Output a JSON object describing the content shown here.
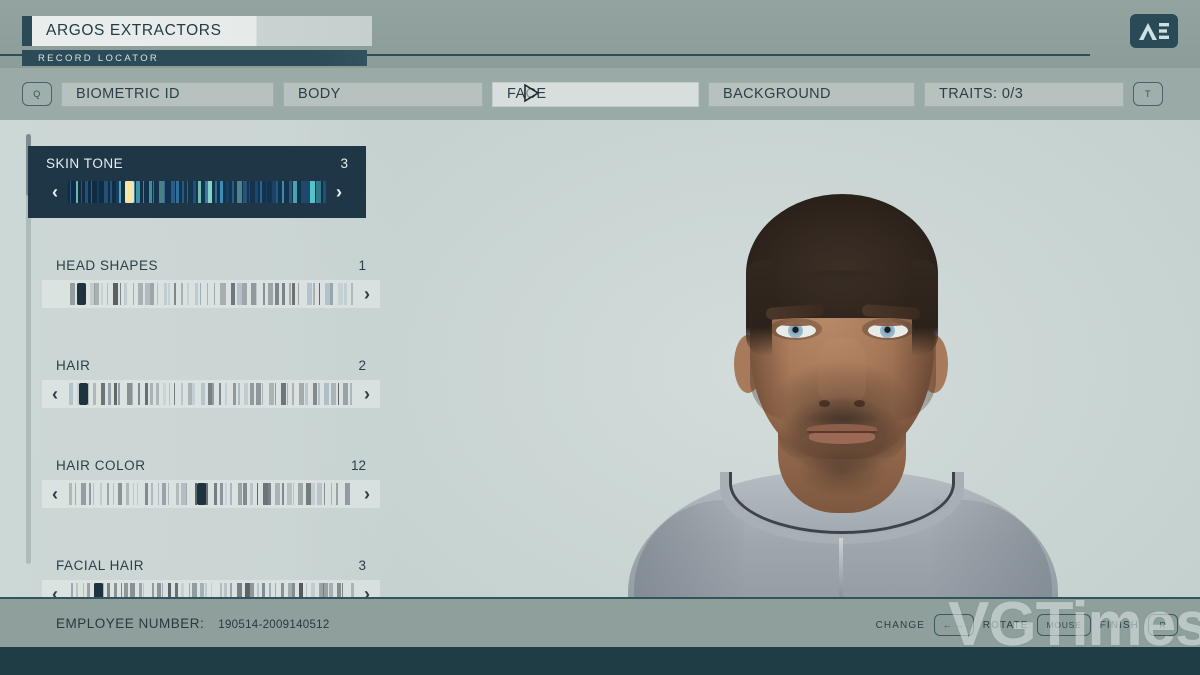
{
  "header": {
    "title": "ARGOS EXTRACTORS",
    "subtitle": "RECORD LOCATOR",
    "logo_icon": "ae-monogram-icon",
    "logo_text": "AE"
  },
  "tabs": {
    "prev_key": "Q",
    "next_key": "T",
    "items": [
      {
        "label": "BIOMETRIC ID",
        "active": false
      },
      {
        "label": "BODY",
        "active": false
      },
      {
        "label": "FACE",
        "active": true
      },
      {
        "label": "BACKGROUND",
        "active": false
      },
      {
        "label": "TRAITS: 0/3",
        "active": false
      }
    ]
  },
  "sidebar": {
    "sliders": [
      {
        "label": "SKIN TONE",
        "value": "3",
        "selected": true,
        "left_chevron": "‹",
        "right_chevron": "›",
        "marker_pct": 22
      },
      {
        "label": "HEAD SHAPES",
        "value": "1",
        "selected": false,
        "left_chevron": "",
        "right_chevron": "›",
        "marker_pct": 3
      },
      {
        "label": "HAIR",
        "value": "2",
        "selected": false,
        "left_chevron": "‹",
        "right_chevron": "›",
        "marker_pct": 4
      },
      {
        "label": "HAIR COLOR",
        "value": "12",
        "selected": false,
        "left_chevron": "‹",
        "right_chevron": "›",
        "marker_pct": 45
      },
      {
        "label": "FACIAL HAIR",
        "value": "3",
        "selected": false,
        "left_chevron": "‹",
        "right_chevron": "›",
        "marker_pct": 9
      }
    ]
  },
  "footer": {
    "employee_label": "EMPLOYEE NUMBER:",
    "employee_value": "190514-2009140512",
    "hints": [
      {
        "label": "CHANGE",
        "key": "←  →"
      },
      {
        "label": "ROTATE",
        "key": "MOUSE"
      },
      {
        "label": "FINISH",
        "key": "R"
      }
    ]
  },
  "overlay": {
    "cursor_icon": "pointer-cursor-icon",
    "watermark": "VGTimes"
  },
  "colors": {
    "chrome": "#8fa09c",
    "stage": "#ccd7d5",
    "accent_dark": "#2b4a57",
    "selected_row": "#1f3647",
    "marker_highlight": "#f5e6a8",
    "letterbox": "#1f3d45"
  }
}
